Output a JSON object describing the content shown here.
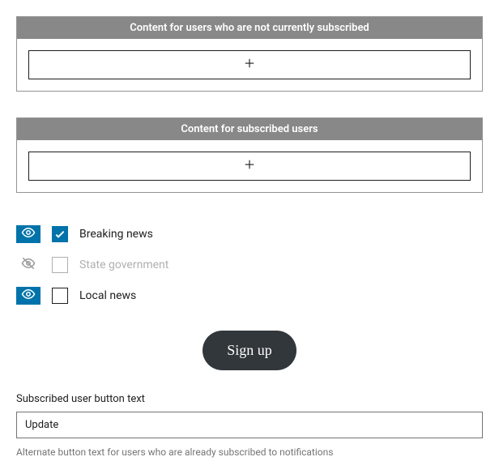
{
  "blocks": {
    "unsubscribed_header": "Content for users who are not currently subscribed",
    "subscribed_header": "Content for subscribed users"
  },
  "topics": [
    {
      "label": "Breaking news",
      "visible": true,
      "checked": true
    },
    {
      "label": "State government",
      "visible": false,
      "checked": false
    },
    {
      "label": "Local news",
      "visible": true,
      "checked": false
    }
  ],
  "signup": {
    "label": "Sign up"
  },
  "field": {
    "label": "Subscribed user button text",
    "value": "Update",
    "help": "Alternate button text for users who are already subscribed to notifications"
  }
}
